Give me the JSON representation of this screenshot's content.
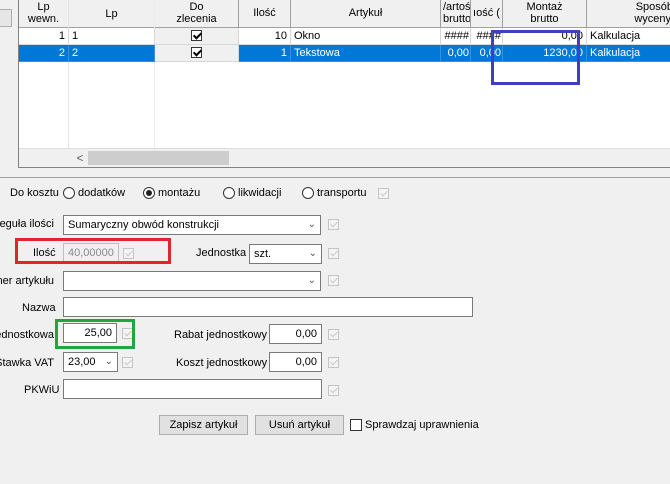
{
  "grid": {
    "headers": {
      "lp_wewn": [
        "Lp",
        "wewn."
      ],
      "lp": "Lp",
      "do_zlecenia": [
        "Do",
        "zlecenia"
      ],
      "ilosc": "Ilość",
      "artykul": "Artykuł",
      "wartosc_brutto": [
        "/artoś",
        "brutto"
      ],
      "ilosc_cut": "ıość (",
      "montaz_brutto": [
        "Montaż",
        "brutto"
      ],
      "sposob": [
        "Sposób",
        "wyceny"
      ]
    },
    "rows": [
      {
        "lp_wewn": "1",
        "lp": "1",
        "do_zlecenia": true,
        "ilosc": "10",
        "artykul": "Okno",
        "wartosc": "####",
        "ilosc2": "####",
        "montaz": "0,00",
        "sposob": "Kalkulacja",
        "selected": false
      },
      {
        "lp_wewn": "2",
        "lp": "2",
        "do_zlecenia": true,
        "ilosc": "1",
        "artykul": "Tekstowa",
        "wartosc": "0,00",
        "ilosc2": "0,00",
        "montaz": "1230,00",
        "sposob": "Kalkulacja",
        "selected": true
      }
    ],
    "scroll_left_glyph": "<"
  },
  "form": {
    "do_kosztu_label": "Do kosztu",
    "radios": [
      {
        "label": "dodatków",
        "checked": false
      },
      {
        "label": "montażu",
        "checked": true
      },
      {
        "label": "likwidacji",
        "checked": false
      },
      {
        "label": "transportu",
        "checked": false
      }
    ],
    "regula_label": "Reguła ilości",
    "regula_value": "Sumaryczny obwód konstrukcji",
    "ilosc_label": "Ilość",
    "ilosc_value": "40,00000",
    "jednostka_label": "Jednostka",
    "jednostka_value": "szt.",
    "numer_label": "Numer artykułu",
    "numer_value": "",
    "nazwa_label": "Nazwa",
    "nazwa_value": "",
    "cena_label": "Cena jednostkowa",
    "cena_value": "25,00",
    "rabat_label": "Rabat jednostkowy",
    "rabat_value": "0,00",
    "vat_label": "Stawka VAT",
    "vat_value": "23,00",
    "koszt_label": "Koszt jednostkowy",
    "koszt_value": "0,00",
    "pkwiu_label": "PKWiU",
    "pkwiu_value": "",
    "zapisz_button": "Zapisz artykuł",
    "usun_button": "Usuń artykuł",
    "sprawdzaj_label": "Sprawdzaj uprawnienia"
  },
  "colors": {
    "selection": "#0078d7",
    "highlight_blue": "#3f3fbf",
    "highlight_red": "#e0262d",
    "highlight_green": "#1fa543"
  }
}
